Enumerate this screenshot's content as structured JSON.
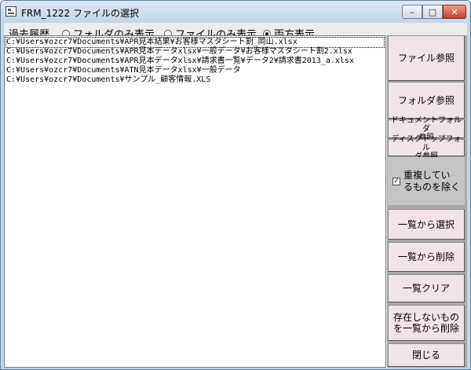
{
  "window": {
    "title": "FRM_1222 ファイルの選択",
    "minimize_glyph": "–",
    "maximize_glyph": "□",
    "close_glyph": "✕",
    "icon": "form-icon"
  },
  "filter": {
    "label": "過去履歴",
    "options": [
      {
        "label": "フォルダのみ表示",
        "selected": false
      },
      {
        "label": "ファイルのみ表示",
        "selected": false
      },
      {
        "label": "両方表示",
        "selected": true
      }
    ]
  },
  "list": {
    "items": [
      "C:¥Users¥ozcr7¥Documents¥APR見本結果¥お客様マスタシート割_岡山.xlsx",
      "C:¥Users¥ozcr7¥Documents¥APR見本データxlsx¥一般データ¥お客様マスタシート割2.xlsx",
      "C:¥Users¥ozcr7¥Documents¥APR見本データxlsx¥請求書一覧¥データ2¥請求書2013_a.xlsx",
      "C:¥Users¥ozcr7¥Documents¥ATN見本データxlsx¥一般データ",
      "C:¥Users¥ozcr7¥Documents¥サンプル_顧客情報.XLS"
    ]
  },
  "side": {
    "browse_file": "ファイル参照",
    "browse_folder": "フォルダ参照",
    "browse_documents": "ドキュメントフォルダ\n参照",
    "browse_desktop": "ディスクトップフォル\nダ参照",
    "exclude_duplicates": "重複してい\nるものを除く",
    "exclude_duplicates_checked": true,
    "select_from_list": "一覧から選択",
    "delete_from_list": "一覧から削除",
    "clear_list": "一覧クリア",
    "remove_missing": "存在しないもの\nを一覧から削除",
    "close": "閉じる"
  },
  "colors": {
    "button_bg": "#f2e4e6",
    "panel_bg": "#a9a9a9",
    "title_bar": "#c3d4e8"
  }
}
